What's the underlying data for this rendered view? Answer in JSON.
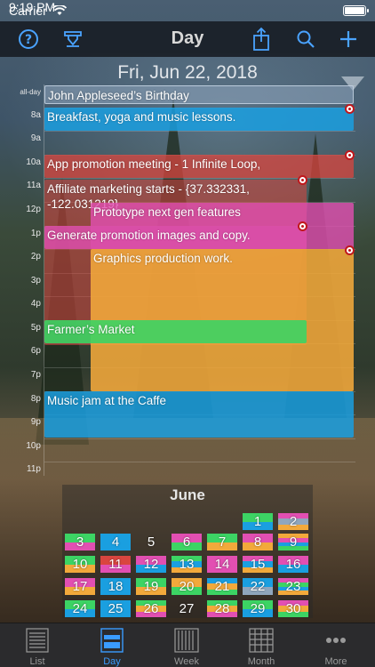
{
  "status_bar": {
    "carrier": "Carrier",
    "time": "9:19 PM"
  },
  "nav": {
    "title": "Day"
  },
  "day_view": {
    "date": "Fri, Jun 22, 2018",
    "hour_labels": [
      "all-day",
      "8a",
      "9a",
      "10a",
      "11a",
      "12p",
      "1p",
      "2p",
      "3p",
      "4p",
      "5p",
      "6p",
      "7p",
      "8p",
      "9p",
      "10p",
      "11p"
    ],
    "events": [
      {
        "title": "John Appleseed’s Birthday",
        "color": "#8fa6bd"
      },
      {
        "title": "Breakfast, yoga and music lessons.",
        "color": "#1a9fe0"
      },
      {
        "title": "App promotion meeting - 1 Infinite Loop,",
        "color": "#d9453f"
      },
      {
        "title": "Affiliate marketing starts - {37.332331, -122.031219}",
        "color": "#d9453f"
      },
      {
        "title": "Prototype next gen features",
        "color": "#e24fb2"
      },
      {
        "title": "Generate promotion images and copy.",
        "color": "#d94fa8"
      },
      {
        "title": "Graphics production work.",
        "color": "#f2a93b"
      },
      {
        "title": "Farmer’s Market",
        "color": "#3cd464"
      },
      {
        "title": "Music jam at the Caffe",
        "color": "#1a9fe0"
      }
    ]
  },
  "mini_month": {
    "title": "June",
    "days": [
      "1",
      "2",
      "3",
      "4",
      "5",
      "6",
      "7",
      "8",
      "9",
      "10",
      "11",
      "12",
      "13",
      "14",
      "15",
      "16",
      "17",
      "18",
      "19",
      "20",
      "21",
      "22",
      "23",
      "24",
      "25",
      "26",
      "27",
      "28",
      "29",
      "30"
    ]
  },
  "tabs": [
    {
      "label": "List",
      "active": false
    },
    {
      "label": "Day",
      "active": true
    },
    {
      "label": "Week",
      "active": false
    },
    {
      "label": "Month",
      "active": false
    },
    {
      "label": "More",
      "active": false
    }
  ],
  "colors": {
    "accent": "#3a9cff",
    "alarm": "#c0181c"
  }
}
